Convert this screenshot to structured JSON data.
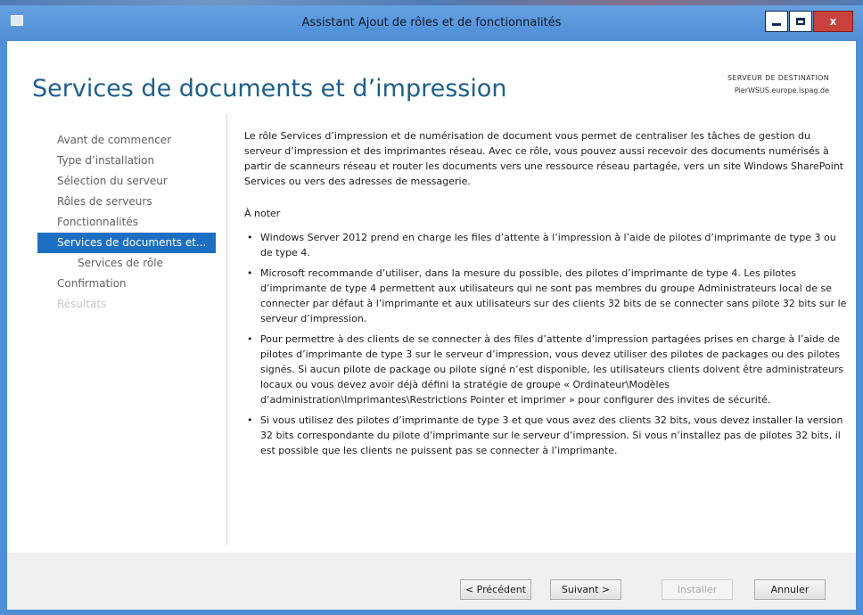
{
  "window": {
    "title": "Assistant Ajout de rôles et de fonctionnalités",
    "controls": {
      "minimize_icon": "minimize-icon",
      "maximize_icon": "maximize-icon",
      "close_label": "x"
    }
  },
  "header": {
    "page_title": "Services de documents et d’impression",
    "destination_label": "SERVEUR DE DESTINATION",
    "destination_server": "PierWSUS.europe.lspag.de"
  },
  "nav": {
    "items": [
      {
        "label": "Avant de commencer",
        "state": "normal"
      },
      {
        "label": "Type d’installation",
        "state": "normal"
      },
      {
        "label": "Sélection du serveur",
        "state": "normal"
      },
      {
        "label": "Rôles de serveurs",
        "state": "normal"
      },
      {
        "label": "Fonctionnalités",
        "state": "normal"
      },
      {
        "label": "Services de documents et...",
        "state": "active"
      },
      {
        "label": "Services de rôle",
        "state": "sub"
      },
      {
        "label": "Confirmation",
        "state": "normal"
      },
      {
        "label": "Résultats",
        "state": "disabled"
      }
    ]
  },
  "content": {
    "intro": "Le rôle Services d’impression et de numérisation de document vous permet de centraliser les tâches de gestion du serveur d’impression et des imprimantes réseau. Avec ce rôle, vous pouvez aussi recevoir des documents numérisés à partir de scanneurs réseau et router les documents vers une ressource réseau partagée, vers un site Windows SharePoint Services ou vers des adresses de messagerie.",
    "note_heading": "À noter",
    "bullet_mark": "•",
    "bullets": [
      "Windows Server 2012 prend en charge les files d’attente à l’impression à l’aide de pilotes d’imprimante de type 3 ou de type 4.",
      "Microsoft recommande d’utiliser, dans la mesure du possible, des pilotes d’imprimante de type 4. Les pilotes d’imprimante de type 4 permettent aux utilisateurs qui ne sont pas membres du groupe Administrateurs local de se connecter par défaut à l’imprimante et aux utilisateurs sur des clients 32 bits de se connecter sans pilote 32 bits sur le serveur d’impression.",
      "Pour permettre à des clients de se connecter à des files d’attente d’impression partagées prises en charge à l’aide de pilotes d’imprimante de type 3 sur le serveur d’impression, vous devez utiliser des pilotes de packages ou des pilotes signés. Si aucun pilote de package ou pilote signé n’est disponible, les utilisateurs clients doivent être administrateurs locaux ou vous devez avoir déjà défini la stratégie de groupe « Ordinateur\\Modèles d’administration\\Imprimantes\\Restrictions Pointer et imprimer » pour configurer des invites de sécurité.",
      "Si vous utilisez des pilotes d’imprimante de type 3 et que vous avez des clients 32 bits, vous devez installer la version 32 bits correspondante du pilote d’imprimante sur le serveur d’impression. Si vous n’installez pas de pilotes 32 bits, il est possible que les clients ne puissent pas se connecter à l’imprimante."
    ]
  },
  "footer": {
    "prev_label": "< Précédent",
    "next_label": "Suivant >",
    "install_label": "Installer",
    "cancel_label": "Annuler"
  }
}
